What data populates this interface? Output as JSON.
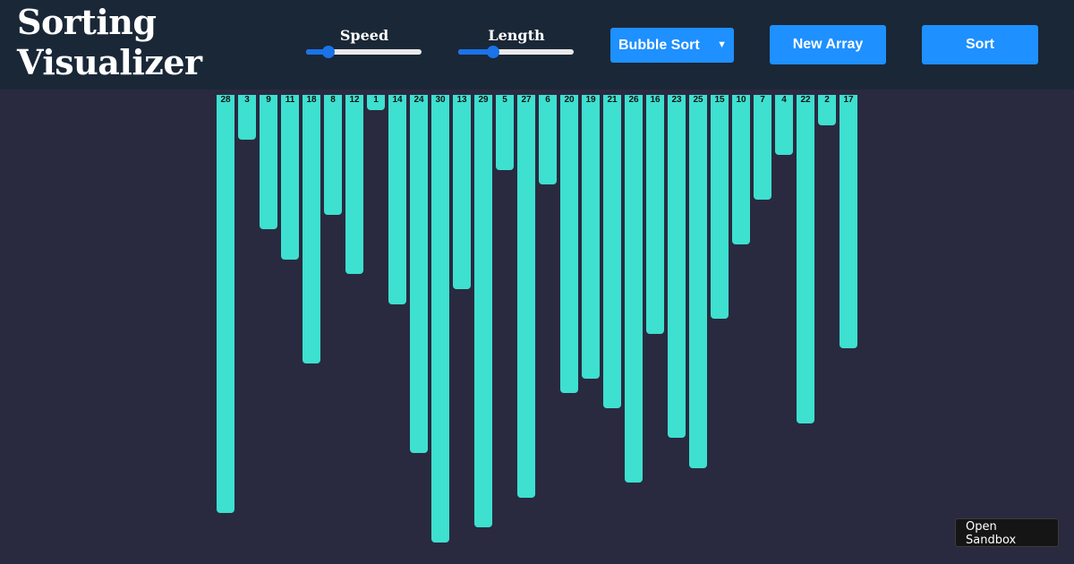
{
  "header": {
    "title_line1": "Sorting",
    "title_line2": "Visualizer"
  },
  "controls": {
    "speed": {
      "label": "Speed",
      "value_fraction": 0.16
    },
    "length": {
      "label": "Length",
      "value_fraction": 0.28
    },
    "algorithm_selected": "Bubble Sort",
    "new_array_label": "New Array",
    "sort_label": "Sort"
  },
  "colors": {
    "accent": "#1e90ff",
    "bar": "#3ee0d0",
    "background": "#292a40",
    "header": "#1a2737"
  },
  "array": {
    "values": [
      28,
      3,
      9,
      11,
      18,
      8,
      12,
      1,
      14,
      24,
      30,
      13,
      29,
      5,
      27,
      6,
      20,
      19,
      21,
      26,
      16,
      23,
      25,
      15,
      10,
      7,
      4,
      22,
      2,
      17
    ],
    "max_value": 30
  },
  "sandbox": {
    "line1": "Open",
    "line2": "Sandbox"
  }
}
